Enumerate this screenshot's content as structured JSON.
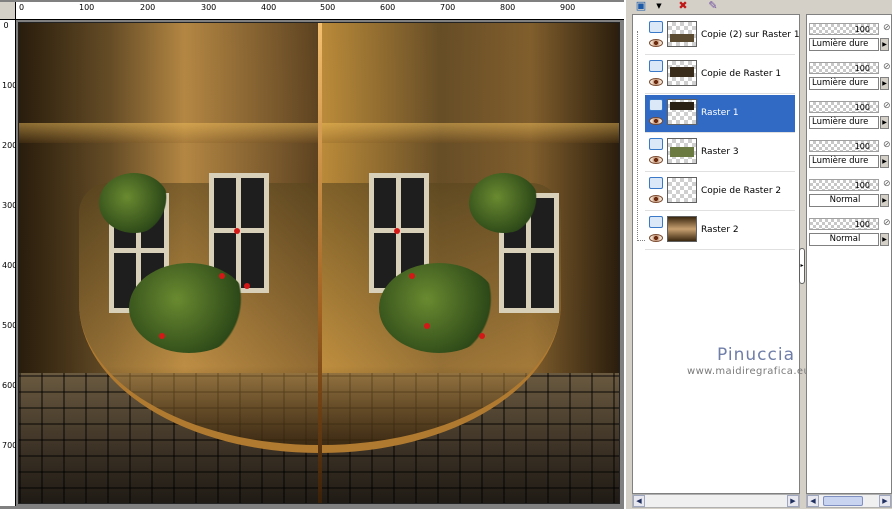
{
  "canvas": {
    "ruler_h_labels": [
      "0",
      "100",
      "200",
      "300",
      "400",
      "500",
      "600",
      "700",
      "800",
      "900"
    ],
    "ruler_v_labels": [
      "0",
      "100",
      "200",
      "300",
      "400",
      "500",
      "600",
      "700"
    ]
  },
  "layers": [
    {
      "name": "Copie (2) sur Raster 1",
      "opacity": "100",
      "blend": "Lumière dure",
      "selected": false
    },
    {
      "name": "Copie de Raster 1",
      "opacity": "100",
      "blend": "Lumière dure",
      "selected": false
    },
    {
      "name": "Raster 1",
      "opacity": "100",
      "blend": "Lumière dure",
      "selected": true
    },
    {
      "name": "Raster 3",
      "opacity": "100",
      "blend": "Lumière dure",
      "selected": false
    },
    {
      "name": "Copie de Raster 2",
      "opacity": "100",
      "blend": "Normal",
      "selected": false
    },
    {
      "name": "Raster 2",
      "opacity": "100",
      "blend": "Normal",
      "selected": false
    }
  ],
  "watermark": {
    "title": "Pinuccia",
    "url": "www.maidiregrafica.eu"
  },
  "colors": {
    "selection": "#316ac5",
    "panel_bg": "#d4d0c8",
    "watermark_title": "#6f7ea8"
  }
}
